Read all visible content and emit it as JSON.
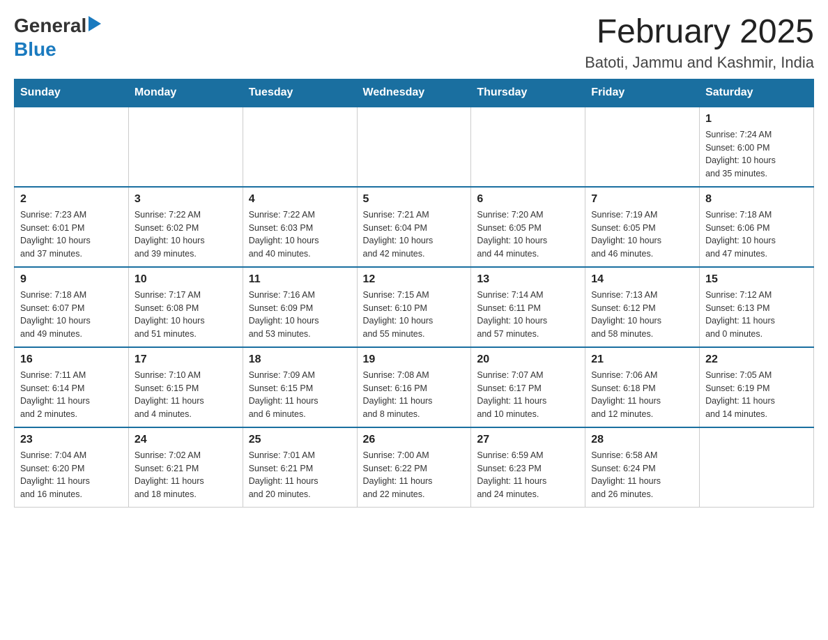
{
  "logo": {
    "general": "General",
    "blue": "Blue"
  },
  "title": "February 2025",
  "subtitle": "Batoti, Jammu and Kashmir, India",
  "days_of_week": [
    "Sunday",
    "Monday",
    "Tuesday",
    "Wednesday",
    "Thursday",
    "Friday",
    "Saturday"
  ],
  "weeks": [
    [
      {
        "day": "",
        "info": ""
      },
      {
        "day": "",
        "info": ""
      },
      {
        "day": "",
        "info": ""
      },
      {
        "day": "",
        "info": ""
      },
      {
        "day": "",
        "info": ""
      },
      {
        "day": "",
        "info": ""
      },
      {
        "day": "1",
        "info": "Sunrise: 7:24 AM\nSunset: 6:00 PM\nDaylight: 10 hours\nand 35 minutes."
      }
    ],
    [
      {
        "day": "2",
        "info": "Sunrise: 7:23 AM\nSunset: 6:01 PM\nDaylight: 10 hours\nand 37 minutes."
      },
      {
        "day": "3",
        "info": "Sunrise: 7:22 AM\nSunset: 6:02 PM\nDaylight: 10 hours\nand 39 minutes."
      },
      {
        "day": "4",
        "info": "Sunrise: 7:22 AM\nSunset: 6:03 PM\nDaylight: 10 hours\nand 40 minutes."
      },
      {
        "day": "5",
        "info": "Sunrise: 7:21 AM\nSunset: 6:04 PM\nDaylight: 10 hours\nand 42 minutes."
      },
      {
        "day": "6",
        "info": "Sunrise: 7:20 AM\nSunset: 6:05 PM\nDaylight: 10 hours\nand 44 minutes."
      },
      {
        "day": "7",
        "info": "Sunrise: 7:19 AM\nSunset: 6:05 PM\nDaylight: 10 hours\nand 46 minutes."
      },
      {
        "day": "8",
        "info": "Sunrise: 7:18 AM\nSunset: 6:06 PM\nDaylight: 10 hours\nand 47 minutes."
      }
    ],
    [
      {
        "day": "9",
        "info": "Sunrise: 7:18 AM\nSunset: 6:07 PM\nDaylight: 10 hours\nand 49 minutes."
      },
      {
        "day": "10",
        "info": "Sunrise: 7:17 AM\nSunset: 6:08 PM\nDaylight: 10 hours\nand 51 minutes."
      },
      {
        "day": "11",
        "info": "Sunrise: 7:16 AM\nSunset: 6:09 PM\nDaylight: 10 hours\nand 53 minutes."
      },
      {
        "day": "12",
        "info": "Sunrise: 7:15 AM\nSunset: 6:10 PM\nDaylight: 10 hours\nand 55 minutes."
      },
      {
        "day": "13",
        "info": "Sunrise: 7:14 AM\nSunset: 6:11 PM\nDaylight: 10 hours\nand 57 minutes."
      },
      {
        "day": "14",
        "info": "Sunrise: 7:13 AM\nSunset: 6:12 PM\nDaylight: 10 hours\nand 58 minutes."
      },
      {
        "day": "15",
        "info": "Sunrise: 7:12 AM\nSunset: 6:13 PM\nDaylight: 11 hours\nand 0 minutes."
      }
    ],
    [
      {
        "day": "16",
        "info": "Sunrise: 7:11 AM\nSunset: 6:14 PM\nDaylight: 11 hours\nand 2 minutes."
      },
      {
        "day": "17",
        "info": "Sunrise: 7:10 AM\nSunset: 6:15 PM\nDaylight: 11 hours\nand 4 minutes."
      },
      {
        "day": "18",
        "info": "Sunrise: 7:09 AM\nSunset: 6:15 PM\nDaylight: 11 hours\nand 6 minutes."
      },
      {
        "day": "19",
        "info": "Sunrise: 7:08 AM\nSunset: 6:16 PM\nDaylight: 11 hours\nand 8 minutes."
      },
      {
        "day": "20",
        "info": "Sunrise: 7:07 AM\nSunset: 6:17 PM\nDaylight: 11 hours\nand 10 minutes."
      },
      {
        "day": "21",
        "info": "Sunrise: 7:06 AM\nSunset: 6:18 PM\nDaylight: 11 hours\nand 12 minutes."
      },
      {
        "day": "22",
        "info": "Sunrise: 7:05 AM\nSunset: 6:19 PM\nDaylight: 11 hours\nand 14 minutes."
      }
    ],
    [
      {
        "day": "23",
        "info": "Sunrise: 7:04 AM\nSunset: 6:20 PM\nDaylight: 11 hours\nand 16 minutes."
      },
      {
        "day": "24",
        "info": "Sunrise: 7:02 AM\nSunset: 6:21 PM\nDaylight: 11 hours\nand 18 minutes."
      },
      {
        "day": "25",
        "info": "Sunrise: 7:01 AM\nSunset: 6:21 PM\nDaylight: 11 hours\nand 20 minutes."
      },
      {
        "day": "26",
        "info": "Sunrise: 7:00 AM\nSunset: 6:22 PM\nDaylight: 11 hours\nand 22 minutes."
      },
      {
        "day": "27",
        "info": "Sunrise: 6:59 AM\nSunset: 6:23 PM\nDaylight: 11 hours\nand 24 minutes."
      },
      {
        "day": "28",
        "info": "Sunrise: 6:58 AM\nSunset: 6:24 PM\nDaylight: 11 hours\nand 26 minutes."
      },
      {
        "day": "",
        "info": ""
      }
    ]
  ]
}
